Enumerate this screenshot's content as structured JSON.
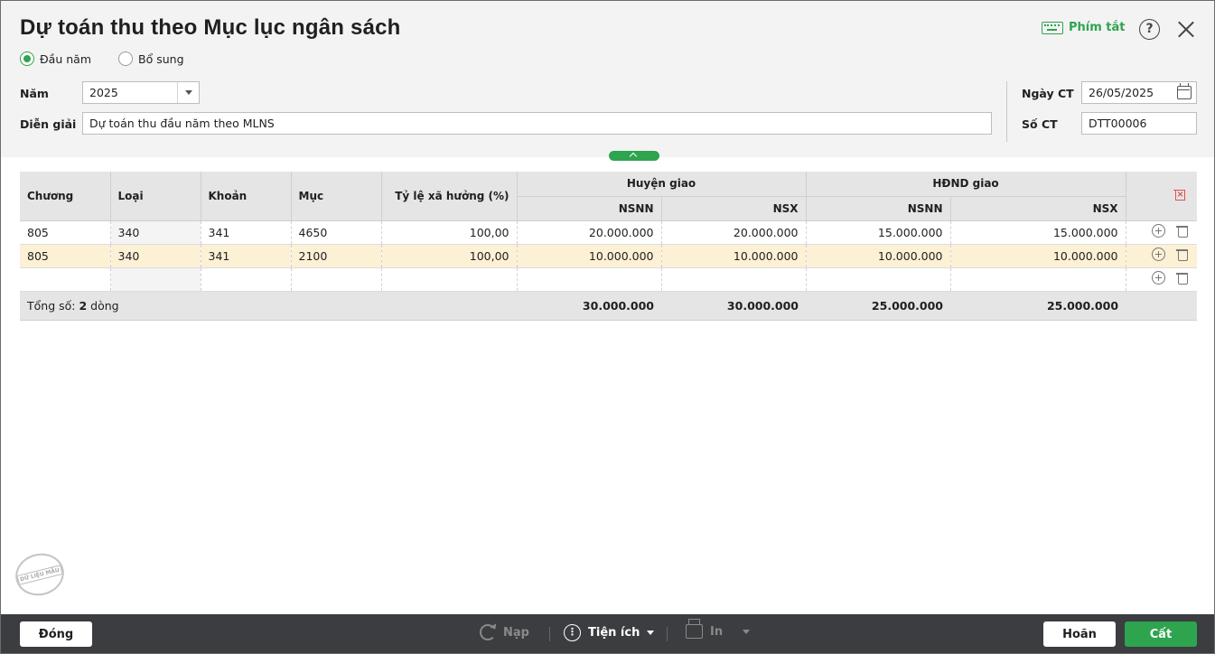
{
  "window": {
    "title": "Dự toán thu theo Mục lục ngân sách",
    "shortcut_label": "Phím tắt"
  },
  "type_options": [
    {
      "label": "Đầu năm",
      "checked": true
    },
    {
      "label": "Bổ sung",
      "checked": false
    }
  ],
  "form": {
    "year_label": "Năm",
    "year_value": "2025",
    "desc_label": "Diễn giải",
    "desc_value": "Dự toán thu đầu năm theo MLNS",
    "date_label": "Ngày CT",
    "date_value": "26/05/2025",
    "doc_label": "Số CT",
    "doc_value": "DTT00006"
  },
  "grid": {
    "headers": {
      "chuong": "Chương",
      "loai": "Loại",
      "khoan": "Khoản",
      "muc": "Mục",
      "ty_le": "Tỷ lệ xã hưởng (%)",
      "huyen_giao": "Huyện giao",
      "hdnd_giao": "HĐND giao",
      "nsnn": "NSNN",
      "nsx": "NSX"
    },
    "rows": [
      {
        "chuong": "805",
        "loai": "340",
        "khoan": "341",
        "muc": "4650",
        "ty_le": "100,00",
        "hg_nsnn": "20.000.000",
        "hg_nsx": "20.000.000",
        "hd_nsnn": "15.000.000",
        "hd_nsx": "15.000.000"
      },
      {
        "chuong": "805",
        "loai": "340",
        "khoan": "341",
        "muc": "2100",
        "ty_le": "100,00",
        "hg_nsnn": "10.000.000",
        "hg_nsx": "10.000.000",
        "hd_nsnn": "10.000.000",
        "hd_nsx": "10.000.000"
      }
    ],
    "total": {
      "label_prefix": "Tổng số:",
      "count": "2",
      "label_suffix": "dòng",
      "hg_nsnn": "30.000.000",
      "hg_nsx": "30.000.000",
      "hd_nsnn": "25.000.000",
      "hd_nsx": "25.000.000"
    }
  },
  "stamp": "DỮ LIỆU MẪU",
  "footer": {
    "close": "Đóng",
    "reload": "Nạp",
    "utilities": "Tiện ích",
    "print": "In",
    "cancel": "Hoãn",
    "save": "Cất"
  },
  "colors": {
    "accent": "#2ea44f",
    "selected_row": "#fcf0d5",
    "footer_bg": "#3b3d40"
  }
}
